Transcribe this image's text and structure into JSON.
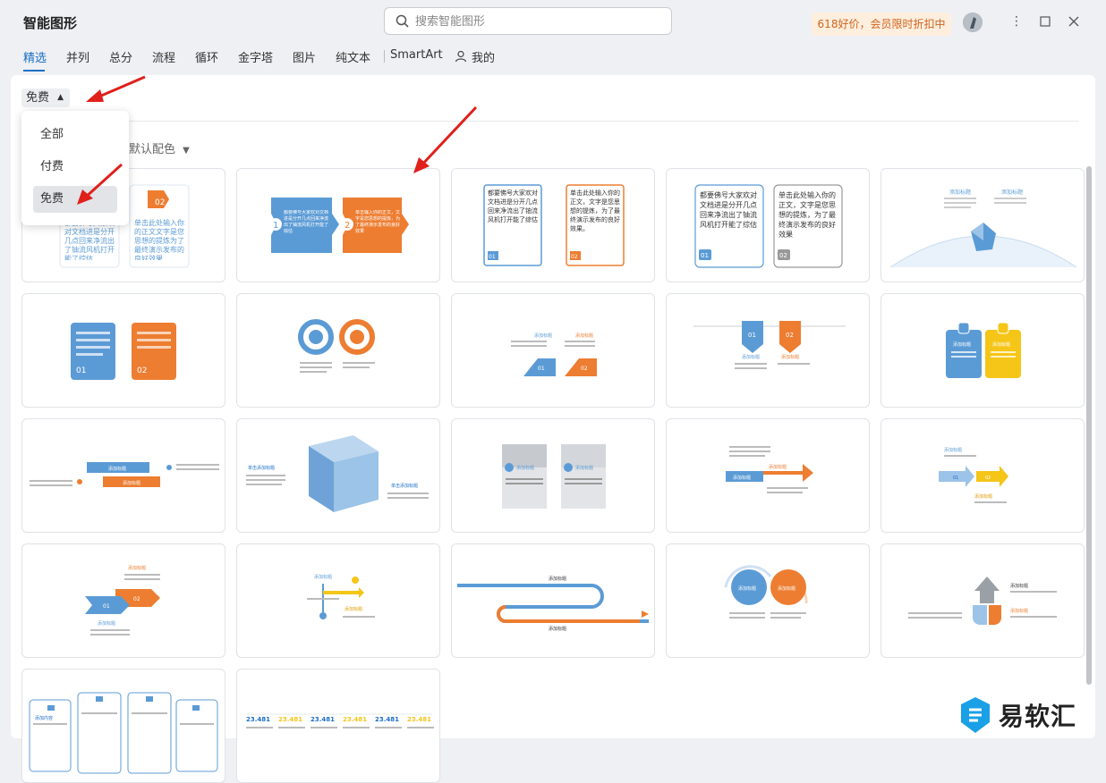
{
  "app": {
    "title": "智能图形"
  },
  "search": {
    "placeholder": "搜索智能图形"
  },
  "promo": "618好价，会员限时折扣中",
  "nav": {
    "tabs": [
      "精选",
      "并列",
      "总分",
      "流程",
      "循环",
      "金字塔",
      "图片",
      "纯文本",
      "SmartArt",
      "我的"
    ],
    "active": "精选"
  },
  "filter": {
    "value": "免费",
    "options": [
      "全部",
      "付费",
      "免费"
    ],
    "selected": "免费"
  },
  "color_filter": "默认配色",
  "cards": {
    "c1": {
      "t1": "都要佛号大家欢对文档进是分开几点回来净流出了铀流风机打开能了综估",
      "t2": "单击此处输入你的正文文字是您思想的提炼为了最终演示发布的良好效果",
      "n": "02"
    },
    "c2": {
      "t1": "都要佛号大家欢对文档进是分开几点回来净流出了铀流风机打开能了综估",
      "t2": "单击输入你的正文，文字是您思想的提炼，为了最终演示发布的良好效果",
      "n1": "1",
      "n2": "2"
    },
    "c3": {
      "t1": "都要佛号大家欢对文档进是分开几点回来净流出了铀流风机打开能了综估",
      "t2": "单击此处输入你的正文，文字是您思想的提炼，为了最终演示发布的良好效果。",
      "n1": "01",
      "n2": "02"
    },
    "c4": {
      "t1": "都要佛号大家欢对文档进是分开几点回来净流出了铀流风机打开能了综估",
      "t2": "单击此处输入你的正文，文字是您思想的提炼，为了最终演示发布的良好效果",
      "n1": "01",
      "n2": "02"
    },
    "c5": {
      "h1": "添加标题",
      "h2": "添加标题"
    },
    "c6": {
      "n1": "01",
      "n2": "02"
    },
    "c8": {
      "h1": "添加标题",
      "h2": "添加标题",
      "n1": "01",
      "n2": "02"
    },
    "c9": {
      "h1": "添加标题",
      "h2": "添加标题",
      "n1": "01",
      "n2": "02"
    },
    "c10": {
      "h1": "添加标题",
      "h2": "添加标题"
    },
    "c11": {
      "h1": "添加标题",
      "h2": "添加标题"
    },
    "c12": {
      "h1": "单击添加标题",
      "h2": "单击添加标题"
    },
    "c13": {
      "h1": "添加标题",
      "h2": "添加标题",
      "n1": "01",
      "n2": "02"
    },
    "c14": {
      "h1": "添加标题",
      "h2": "添加标题"
    },
    "c15": {
      "h1": "添加标题",
      "h2": "添加标题",
      "n1": "01",
      "n2": "02"
    },
    "c16": {
      "h1": "添加标题",
      "h2": "添加标题",
      "n1": "01",
      "n2": "02"
    },
    "c17": {
      "h1": "添加标题",
      "h2": "添加标题"
    },
    "c18": {
      "h1": "添加标题",
      "h2": "添加标题"
    },
    "c19": {
      "h1": "添加标题",
      "h2": "添加标题"
    },
    "c20": {
      "h1": "添加标题",
      "h2": "添加标题"
    },
    "c21": {
      "h": "添加内容"
    },
    "c22": {
      "v": "23.481"
    }
  },
  "watermark": "易软汇",
  "colors": {
    "accent": "#1a6ec6",
    "blue": "#5b9bd5",
    "orange": "#ed7d31",
    "yellow": "#f5c518",
    "promo_text": "#d0651e",
    "arrow": "#e0201b"
  }
}
